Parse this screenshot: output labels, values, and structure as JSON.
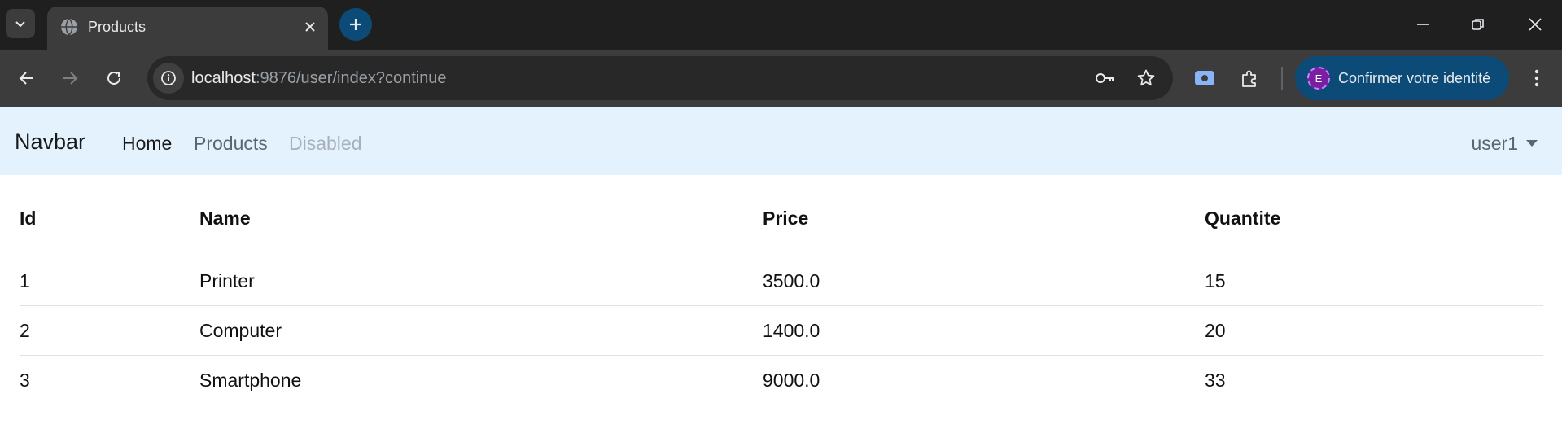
{
  "browser": {
    "tab": {
      "title": "Products"
    },
    "url": {
      "host": "localhost",
      "rest": ":9876/user/index?continue"
    },
    "profile": {
      "label": "Confirmer votre identité",
      "avatar_letter": "E"
    },
    "colors": {
      "tabstrip": "#1f1f1f",
      "toolbar": "#3c3c3c",
      "accent": "#0c4b77"
    }
  },
  "navbar": {
    "brand": "Navbar",
    "links": [
      {
        "label": "Home"
      },
      {
        "label": "Products"
      },
      {
        "label": "Disabled"
      }
    ],
    "user": "user1",
    "background": "#e3f2fd"
  },
  "table": {
    "headers": [
      "Id",
      "Name",
      "Price",
      "Quantite"
    ],
    "rows": [
      [
        "1",
        "Printer",
        "3500.0",
        "15"
      ],
      [
        "2",
        "Computer",
        "1400.0",
        "20"
      ],
      [
        "3",
        "Smartphone",
        "9000.0",
        "33"
      ]
    ]
  }
}
